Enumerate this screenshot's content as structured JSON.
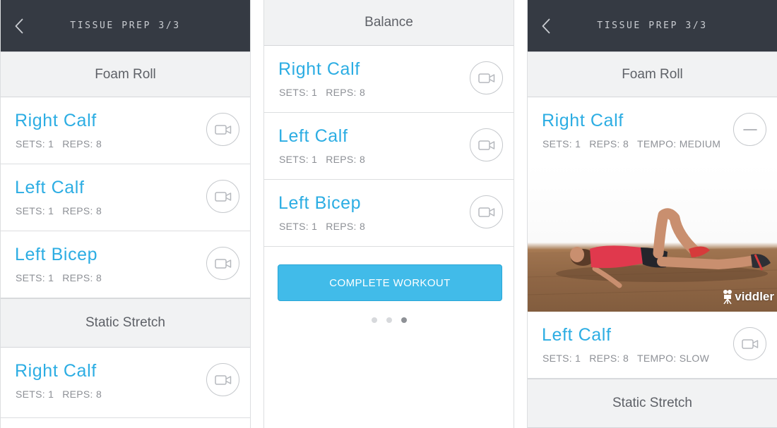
{
  "colors": {
    "header_bg": "#353a43",
    "accent": "#2cade3",
    "button_bg": "#41bbe9",
    "section_bg": "#f1f2f3"
  },
  "screens": [
    {
      "header": {
        "title": "TISSUE PREP 3/3",
        "back_icon": "chevron-left-icon"
      },
      "sections": [
        {
          "label": "Foam Roll",
          "exercises": [
            {
              "name": "Right Calf",
              "sets_label": "SETS: 1",
              "reps_label": "REPS: 8",
              "action_icon": "video-camera-icon"
            },
            {
              "name": "Left Calf",
              "sets_label": "SETS: 1",
              "reps_label": "REPS: 8",
              "action_icon": "video-camera-icon"
            },
            {
              "name": "Left Bicep",
              "sets_label": "SETS: 1",
              "reps_label": "REPS: 8",
              "action_icon": "video-camera-icon"
            }
          ]
        },
        {
          "label": "Static Stretch",
          "exercises": [
            {
              "name": "Right Calf",
              "sets_label": "SETS: 1",
              "reps_label": "REPS: 8",
              "action_icon": "video-camera-icon"
            }
          ]
        }
      ]
    },
    {
      "sections": [
        {
          "label": "Balance",
          "exercises": [
            {
              "name": "Right Calf",
              "sets_label": "SETS: 1",
              "reps_label": "REPS: 8",
              "action_icon": "video-camera-icon"
            },
            {
              "name": "Left Calf",
              "sets_label": "SETS: 1",
              "reps_label": "REPS: 8",
              "action_icon": "video-camera-icon"
            },
            {
              "name": "Left Bicep",
              "sets_label": "SETS: 1",
              "reps_label": "REPS: 8",
              "action_icon": "video-camera-icon"
            }
          ]
        }
      ],
      "complete_button": "COMPLETE WORKOUT",
      "pager": {
        "count": 3,
        "active_index": 2
      }
    },
    {
      "header": {
        "title": "TISSUE PREP 3/3",
        "back_icon": "chevron-left-icon"
      },
      "sections": [
        {
          "label": "Foam Roll",
          "exercises": [
            {
              "name": "Right Calf",
              "sets_label": "SETS: 1",
              "reps_label": "REPS: 8",
              "tempo_label": "TEMPO: MEDIUM",
              "action_icon": "minus-icon",
              "expanded": true
            },
            {
              "name": "Left Calf",
              "sets_label": "SETS: 1",
              "reps_label": "REPS: 8",
              "tempo_label": "TEMPO: SLOW",
              "action_icon": "video-camera-icon"
            }
          ]
        },
        {
          "label": "Static Stretch",
          "exercises": []
        }
      ],
      "video": {
        "description_icon": "exercise-video-thumbnail",
        "watermark": "viddler"
      }
    }
  ]
}
